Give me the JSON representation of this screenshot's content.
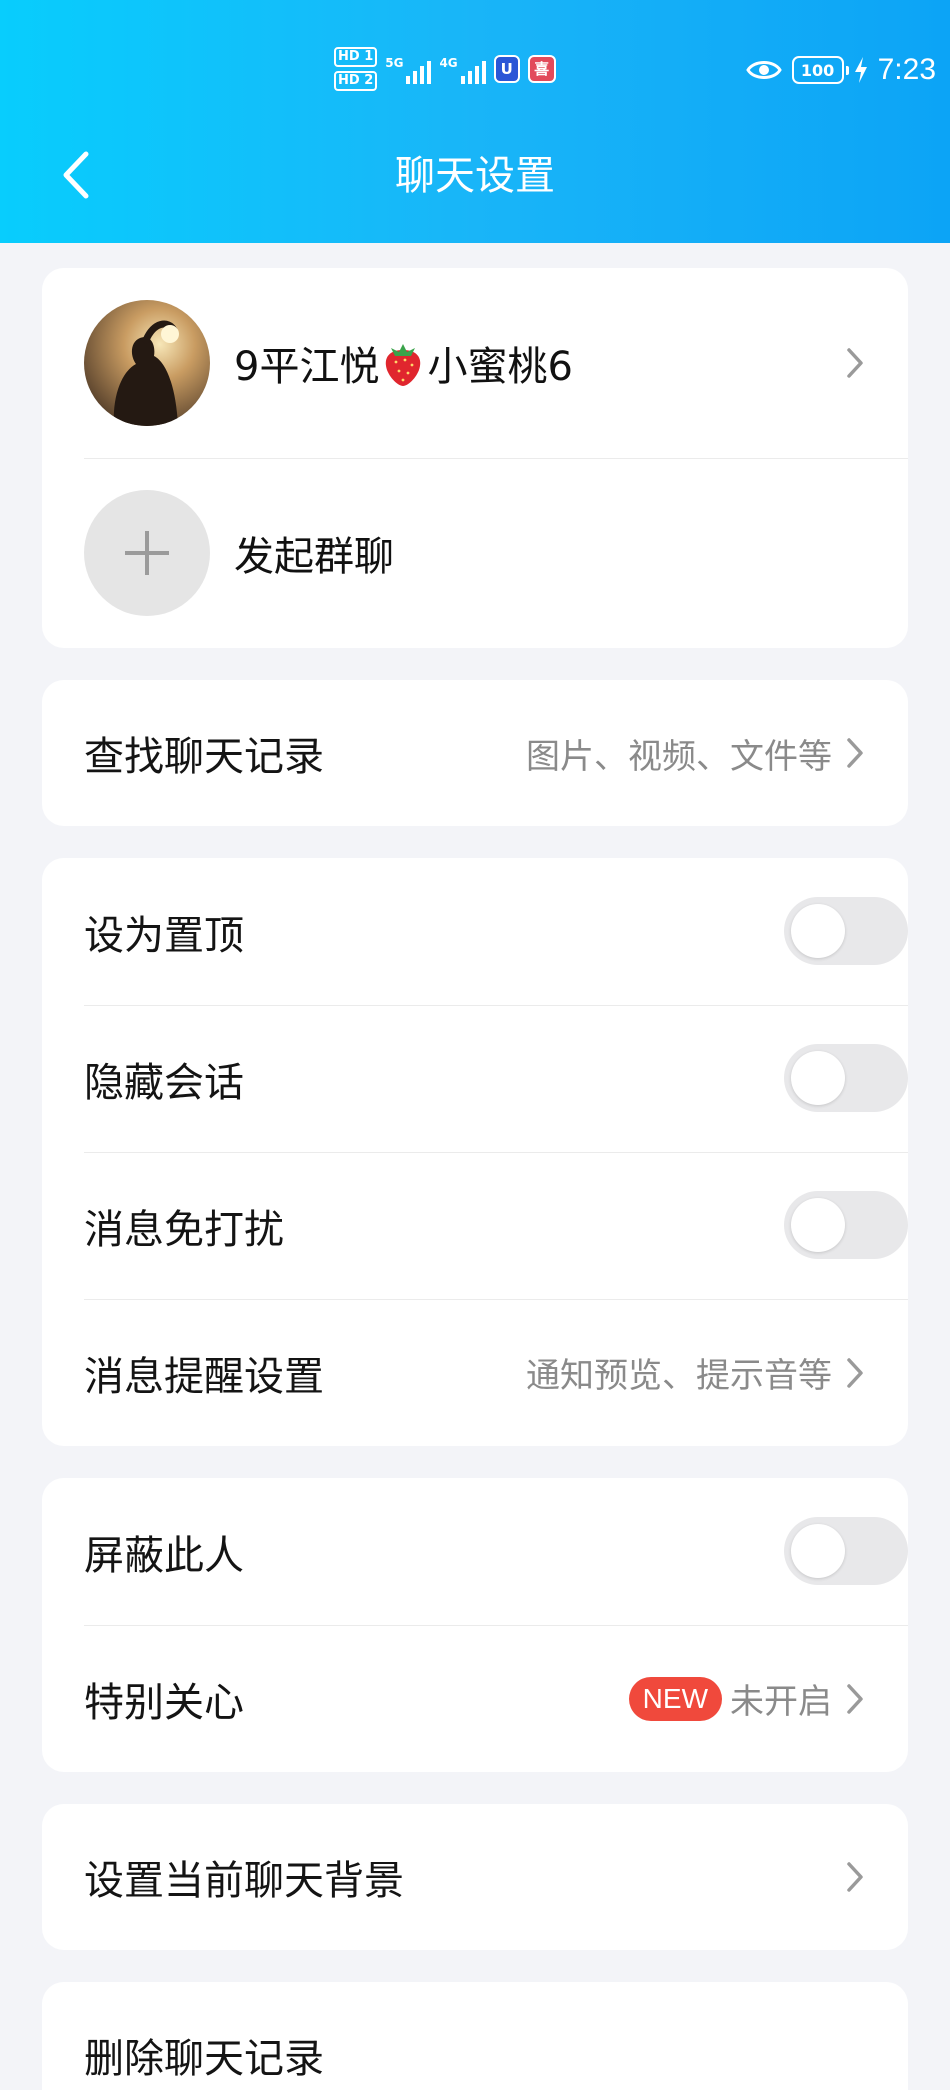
{
  "status_bar": {
    "hd1": "HD 1",
    "hd2": "HD 2",
    "net1": "5G",
    "net2": "4G",
    "app1": "U",
    "app2": "喜",
    "battery": "100",
    "time": "7:23"
  },
  "header": {
    "title": "聊天设置"
  },
  "contact": {
    "name_prefix": "9平江悦",
    "name_emoji": "strawberry-emoji",
    "name_suffix": "小蜜桃6"
  },
  "start_group": {
    "label": "发起群聊"
  },
  "search_history": {
    "label": "查找聊天记录",
    "hint": "图片、视频、文件等"
  },
  "settings": {
    "pin": {
      "label": "设为置顶",
      "on": false
    },
    "hide": {
      "label": "隐藏会话",
      "on": false
    },
    "mute": {
      "label": "消息免打扰",
      "on": false
    },
    "notify": {
      "label": "消息提醒设置",
      "hint": "通知预览、提示音等"
    }
  },
  "privacy": {
    "block": {
      "label": "屏蔽此人",
      "on": false
    },
    "special_care": {
      "label": "特别关心",
      "badge": "NEW",
      "status": "未开启"
    }
  },
  "background": {
    "label": "设置当前聊天背景"
  },
  "delete_history": {
    "label": "删除聊天记录"
  },
  "colors": {
    "header_gradient": [
      "#08cdfd",
      "#0ca4f6"
    ],
    "page_bg": "#f3f4f8",
    "badge_red": "#f0493c",
    "toggle_off": "#e8e8ea"
  }
}
